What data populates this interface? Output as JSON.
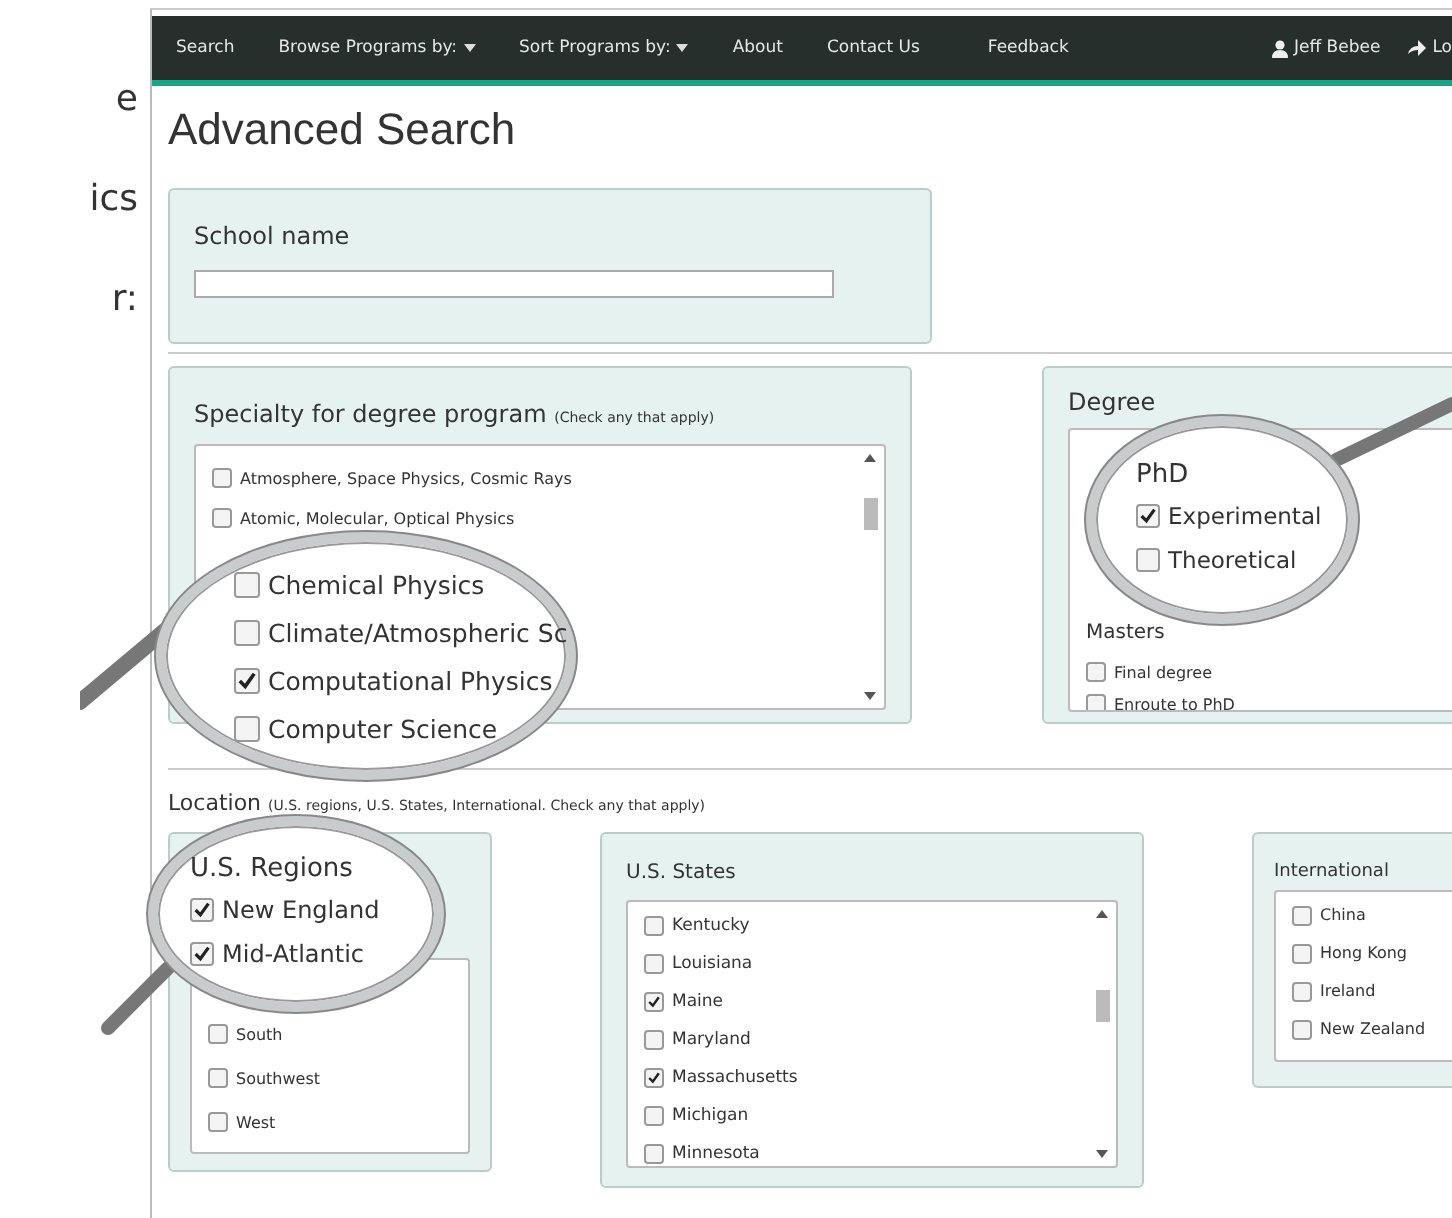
{
  "margin_text": [
    "e",
    "ics",
    "r:"
  ],
  "nav": {
    "items": [
      {
        "label": "Search",
        "dropdown": false
      },
      {
        "label": "Browse Programs by:",
        "dropdown": true
      },
      {
        "label": "Sort Programs by:",
        "dropdown": true
      },
      {
        "label": "About",
        "dropdown": false
      },
      {
        "label": "Contact Us",
        "dropdown": false
      },
      {
        "label": "Feedback",
        "dropdown": false
      }
    ],
    "user": "Jeff Bebee",
    "logout": "Lo"
  },
  "title": "Advanced Search",
  "school": {
    "label": "School name"
  },
  "specialty": {
    "title": "Specialty for degree program",
    "hint": "(Check any that apply)",
    "items": [
      {
        "label": "Atmosphere, Space Physics, Cosmic Rays",
        "checked": false
      },
      {
        "label": "Atomic, Molecular, Optical Physics",
        "checked": false
      }
    ],
    "lens": [
      {
        "label": "Chemical Physics",
        "checked": false
      },
      {
        "label": "Climate/Atmospheric Sc",
        "checked": false
      },
      {
        "label": "Computational Physics",
        "checked": true
      },
      {
        "label": "Computer Science",
        "checked": false
      }
    ]
  },
  "degree": {
    "title": "Degree",
    "lens_heading": "PhD",
    "lens": [
      {
        "label": "Experimental",
        "checked": true
      },
      {
        "label": "Theoretical",
        "checked": false
      }
    ],
    "group": "Masters",
    "items": [
      {
        "label": "Final degree",
        "checked": false
      },
      {
        "label": "Enroute to PhD",
        "checked": false
      }
    ]
  },
  "location": {
    "title": "Location",
    "hint": "(U.S. regions, U.S. States, International. Check any that apply)"
  },
  "regions": {
    "title": "U.S. Regions",
    "lens": [
      {
        "label": "New England",
        "checked": true
      },
      {
        "label": "Mid-Atlantic",
        "checked": true
      }
    ],
    "items": [
      {
        "label": "South",
        "checked": false
      },
      {
        "label": "Southwest",
        "checked": false
      },
      {
        "label": "West",
        "checked": false
      }
    ]
  },
  "states": {
    "title": "U.S. States",
    "items": [
      {
        "label": "Kentucky",
        "checked": false
      },
      {
        "label": "Louisiana",
        "checked": false
      },
      {
        "label": "Maine",
        "checked": true
      },
      {
        "label": "Maryland",
        "checked": false
      },
      {
        "label": "Massachusetts",
        "checked": true
      },
      {
        "label": "Michigan",
        "checked": false
      },
      {
        "label": "Minnesota",
        "checked": false
      }
    ]
  },
  "international": {
    "title": "International",
    "items": [
      {
        "label": "China",
        "checked": false
      },
      {
        "label": "Hong Kong",
        "checked": false
      },
      {
        "label": "Ireland",
        "checked": false
      },
      {
        "label": "New Zealand",
        "checked": false
      }
    ]
  }
}
